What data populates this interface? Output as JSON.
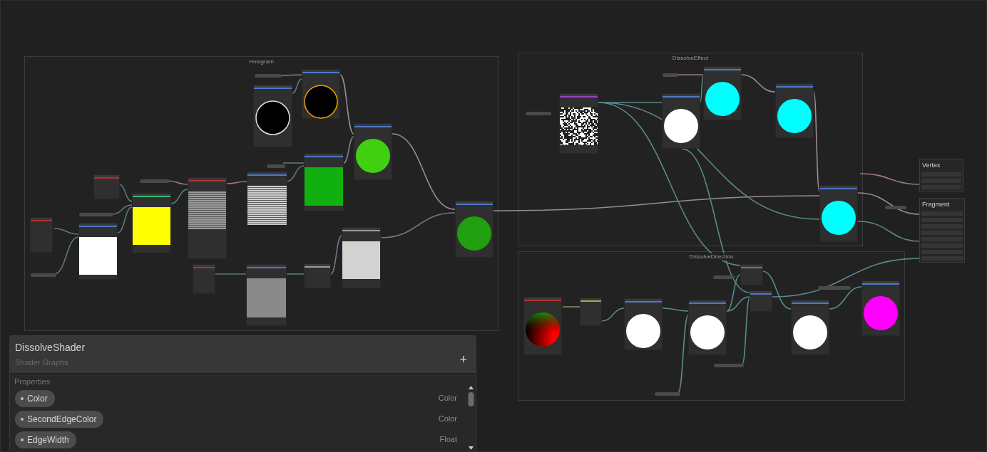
{
  "graph_groups": [
    {
      "title": "Hologram"
    },
    {
      "title": "DissolveEffect"
    },
    {
      "title": "DissolveDirection"
    }
  ],
  "nodes": [
    {
      "kind": "none"
    },
    {
      "kind": "square",
      "color": "#ffffff"
    },
    {
      "kind": "none"
    },
    {
      "kind": "square",
      "color": "#ffff00"
    },
    {
      "kind": "stripes",
      "color": "#9a9a9a"
    },
    {
      "kind": "none"
    },
    {
      "kind": "stripes",
      "color": "#d0d0d0"
    },
    {
      "kind": "ring",
      "color": "#e0e0e0"
    },
    {
      "kind": "ring",
      "color": "#f0a000"
    },
    {
      "kind": "square",
      "color": "#10b010"
    },
    {
      "kind": "circle",
      "color": "#40d010"
    },
    {
      "kind": "square",
      "color": "#8a8a8a"
    },
    {
      "kind": "none"
    },
    {
      "kind": "square",
      "color": "#d2d2d2"
    },
    {
      "kind": "circle",
      "color": "#20a010"
    },
    {
      "kind": "noise",
      "color": "#ffffff"
    },
    {
      "kind": "circle",
      "color": "#ffffff"
    },
    {
      "kind": "circle",
      "color": "#00ffff"
    },
    {
      "kind": "circle",
      "color": "#00ffff"
    },
    {
      "kind": "circle",
      "color": "#00ffff"
    },
    {
      "kind": "gradient",
      "color": "#ff0000"
    },
    {
      "kind": "none"
    },
    {
      "kind": "circle",
      "color": "#ffffff"
    },
    {
      "kind": "circle",
      "color": "#ffffff"
    },
    {
      "kind": "none"
    },
    {
      "kind": "none"
    },
    {
      "kind": "circle",
      "color": "#ffffff"
    },
    {
      "kind": "circle",
      "color": "#ff00ff"
    }
  ],
  "master_stack": [
    {
      "title": "Vertex"
    },
    {
      "title": "Fragment"
    }
  ],
  "blackboard": {
    "title": "DissolveShader",
    "subtitle": "Shader Graphs",
    "add_button": "+",
    "section": "Properties",
    "properties": [
      {
        "name": "Color",
        "type": "Color"
      },
      {
        "name": "SecondEdgeColor",
        "type": "Color"
      },
      {
        "name": "EdgeWidth",
        "type": "Float"
      }
    ]
  }
}
